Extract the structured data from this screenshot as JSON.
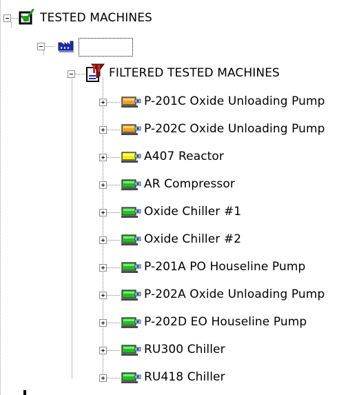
{
  "tree": {
    "root": {
      "label": "TESTED MACHINES",
      "icon": "checked-checkbox-icon",
      "expanded": true
    },
    "site": {
      "label": "",
      "icon": "factory-icon",
      "expanded": true
    },
    "filter": {
      "label": "FILTERED TESTED MACHINES",
      "icon": "filter-document-icon",
      "expanded": true
    },
    "machines": [
      {
        "label": "P-201C Oxide Unloading Pump",
        "status_color": "#f0a020"
      },
      {
        "label": "P-202C Oxide Unloading Pump",
        "status_color": "#f0a020"
      },
      {
        "label": "A407 Reactor",
        "status_color": "#f0f000"
      },
      {
        "label": "AR Compressor",
        "status_color": "#20c020"
      },
      {
        "label": "Oxide Chiller #1",
        "status_color": "#20c020"
      },
      {
        "label": "Oxide Chiller #2",
        "status_color": "#20c020"
      },
      {
        "label": "P-201A PO Houseline Pump",
        "status_color": "#20c020"
      },
      {
        "label": "P-202A Oxide Unloading Pump",
        "status_color": "#20c020"
      },
      {
        "label": "P-202D EO Houseline Pump",
        "status_color": "#20c020"
      },
      {
        "label": "RU300 Chiller",
        "status_color": "#20c020"
      },
      {
        "label": "RU418 Chiller",
        "status_color": "#20c020"
      }
    ]
  }
}
